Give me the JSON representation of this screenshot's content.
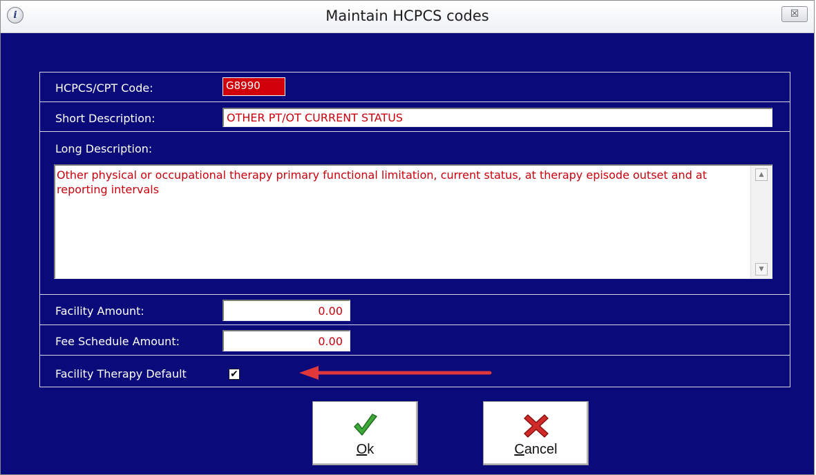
{
  "window": {
    "title": "Maintain HCPCS codes",
    "info_icon": "info-icon",
    "close_icon": "close-icon",
    "close_glyph": "☒"
  },
  "form": {
    "code_label": "HCPCS/CPT Code:",
    "code_value": "G8990",
    "short_desc_label": "Short Description:",
    "short_desc_value": "OTHER PT/OT CURRENT STATUS",
    "long_desc_label": "Long Description:",
    "long_desc_value": "Other physical or occupational therapy primary functional limitation, current status, at therapy episode outset and at reporting intervals",
    "facility_amount_label": "Facility Amount:",
    "facility_amount_value": "0.00",
    "fee_schedule_label": "Fee Schedule Amount:",
    "fee_schedule_value": "0.00",
    "therapy_default_label": "Facility Therapy Default",
    "therapy_default_checked": true
  },
  "buttons": {
    "ok": {
      "underlined": "O",
      "rest": "k",
      "icon": "checkmark-icon"
    },
    "cancel": {
      "underlined": "C",
      "rest": "ancel",
      "icon": "x-icon"
    }
  },
  "colors": {
    "background": "#0a0a7a",
    "field_text": "#c8000c",
    "code_field_bg": "#d0000a",
    "annotation_arrow": "#e0383a"
  }
}
